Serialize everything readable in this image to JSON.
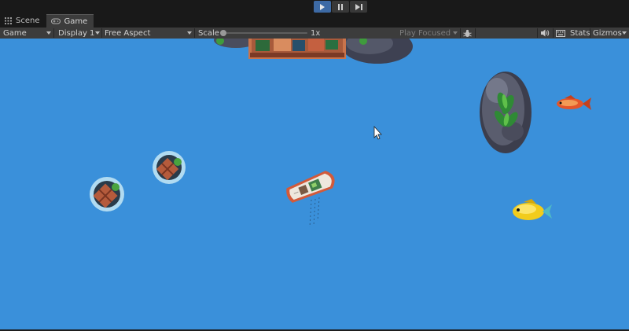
{
  "play_controls": {
    "play_icon": "play-icon",
    "pause_icon": "pause-icon",
    "step_icon": "step-icon",
    "active": "play"
  },
  "tabs": [
    {
      "label": "Scene",
      "icon": "scene-grid-icon",
      "active": false
    },
    {
      "label": "Game",
      "icon": "gamepad-icon",
      "active": true
    }
  ],
  "toolbar": {
    "view_mode": "Game",
    "display": "Display 1",
    "aspect": "Free Aspect",
    "scale_label": "Scale",
    "scale_value": "1x",
    "play_focused": "Play Focused",
    "bug_icon": "bug-icon",
    "audio_icon": "speaker-icon",
    "stats_icon": "keyboard-icon",
    "stats_label": "Stats",
    "gizmos_label": "Gizmos"
  },
  "colors": {
    "water": "#3a90da",
    "editor_bg": "#191919",
    "toolbar_bg": "#3c3c3c",
    "play_active": "#3d6aa5"
  },
  "scene": {
    "sprites": [
      "dock-platform",
      "rock-island",
      "orange-fish",
      "yellow-fish",
      "fishing-boat",
      "crate-float",
      "crate-float",
      "mouse-cursor"
    ]
  }
}
